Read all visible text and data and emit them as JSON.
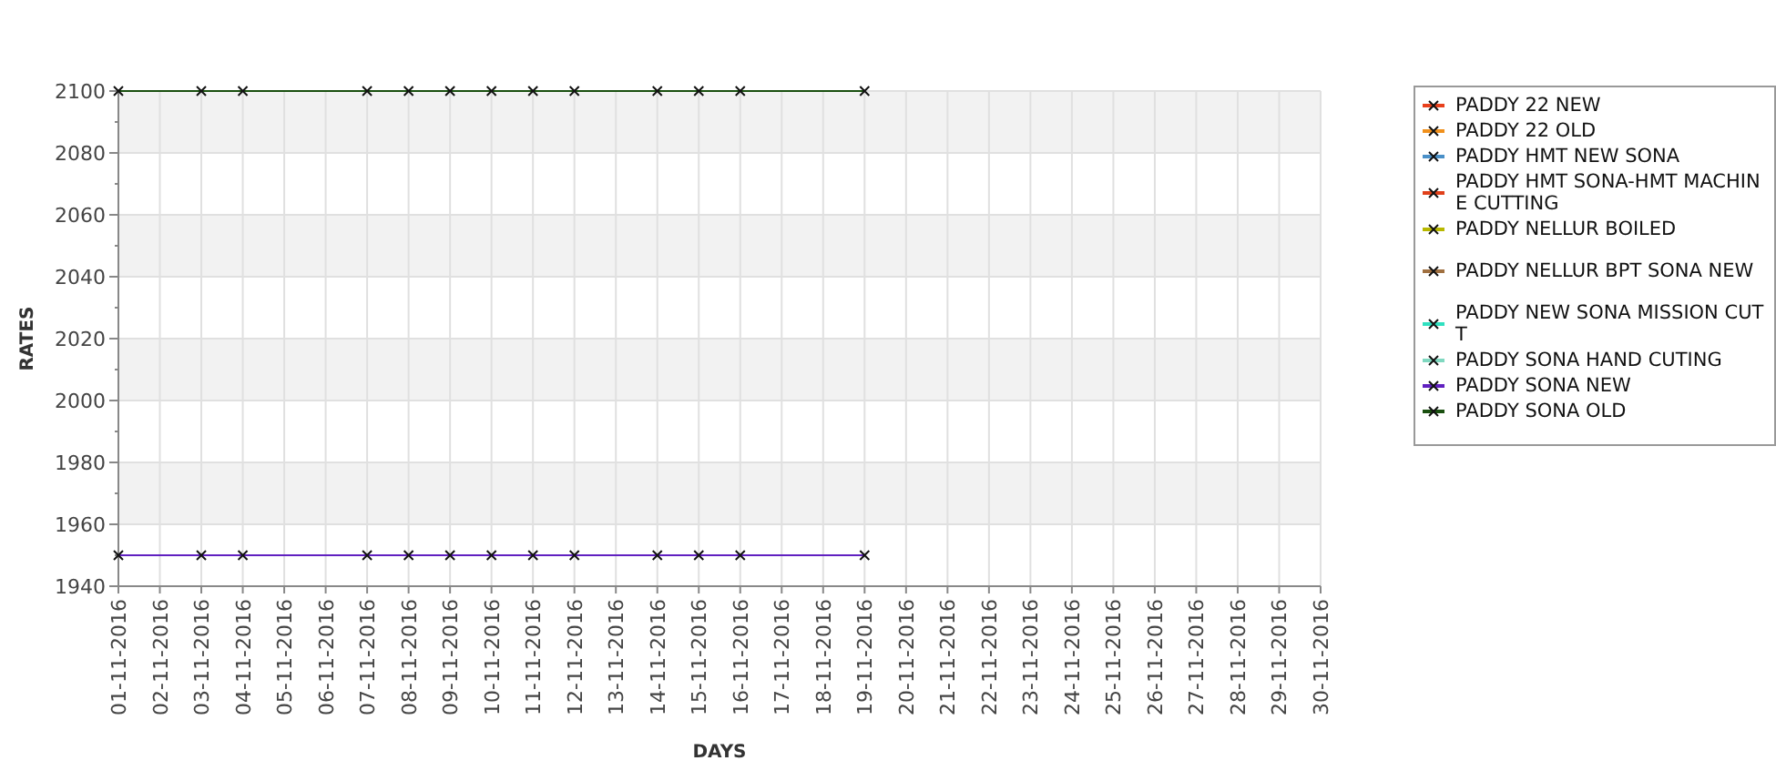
{
  "chart": {
    "chart_data": {
      "type": "line",
      "xlabel": "DAYS",
      "ylabel": "RATES",
      "categories": [
        "01-11-2016",
        "02-11-2016",
        "03-11-2016",
        "04-11-2016",
        "05-11-2016",
        "06-11-2016",
        "07-11-2016",
        "08-11-2016",
        "09-11-2016",
        "10-11-2016",
        "11-11-2016",
        "12-11-2016",
        "13-11-2016",
        "14-11-2016",
        "15-11-2016",
        "16-11-2016",
        "17-11-2016",
        "18-11-2016",
        "19-11-2016",
        "20-11-2016",
        "21-11-2016",
        "22-11-2016",
        "23-11-2016",
        "24-11-2016",
        "25-11-2016",
        "26-11-2016",
        "27-11-2016",
        "28-11-2016",
        "29-11-2016",
        "30-11-2016"
      ],
      "ylim": [
        1940,
        2100
      ],
      "grid": true,
      "yticks": [
        1940,
        1960,
        1980,
        2000,
        2020,
        2040,
        2060,
        2080,
        2100
      ],
      "series": [
        {
          "name": "PADDY 22 NEW",
          "color": "#e8401c",
          "marker": "x",
          "values": [
            null,
            null,
            null,
            null,
            null,
            null,
            null,
            null,
            null,
            null,
            null,
            null,
            null,
            null,
            null,
            null,
            null,
            null,
            null,
            null,
            null,
            null,
            null,
            null,
            null,
            null,
            null,
            null,
            null,
            null
          ]
        },
        {
          "name": "PADDY 22 OLD",
          "color": "#f0901c",
          "marker": "x",
          "values": [
            null,
            null,
            null,
            null,
            null,
            null,
            null,
            null,
            null,
            null,
            null,
            null,
            null,
            null,
            null,
            null,
            null,
            null,
            null,
            null,
            null,
            null,
            null,
            null,
            null,
            null,
            null,
            null,
            null,
            null
          ]
        },
        {
          "name": "PADDY HMT NEW SONA",
          "color": "#4a90c8",
          "marker": "x",
          "values": [
            null,
            null,
            null,
            null,
            null,
            null,
            null,
            null,
            null,
            null,
            null,
            null,
            null,
            null,
            null,
            null,
            null,
            null,
            null,
            null,
            null,
            null,
            null,
            null,
            null,
            null,
            null,
            null,
            null,
            null
          ]
        },
        {
          "name": "PADDY HMT SONA-HMT MACHINE CUTTING",
          "color": "#e0401a",
          "marker": "x",
          "values": [
            null,
            null,
            null,
            null,
            null,
            null,
            null,
            null,
            null,
            null,
            null,
            null,
            null,
            null,
            null,
            null,
            null,
            null,
            null,
            null,
            null,
            null,
            null,
            null,
            null,
            null,
            null,
            null,
            null,
            null
          ]
        },
        {
          "name": "PADDY NELLUR BOILED",
          "color": "#b8b800",
          "marker": "x",
          "values": [
            null,
            null,
            null,
            null,
            null,
            null,
            null,
            null,
            null,
            null,
            null,
            null,
            null,
            null,
            null,
            null,
            null,
            null,
            null,
            null,
            null,
            null,
            null,
            null,
            null,
            null,
            null,
            null,
            null,
            null
          ]
        },
        {
          "name": "PADDY NELLUR BPT SONA NEW",
          "color": "#a07040",
          "marker": "x",
          "values": [
            null,
            null,
            null,
            null,
            null,
            null,
            null,
            null,
            null,
            null,
            null,
            null,
            null,
            null,
            null,
            null,
            null,
            null,
            null,
            null,
            null,
            null,
            null,
            null,
            null,
            null,
            null,
            null,
            null,
            null
          ]
        },
        {
          "name": "PADDY NEW SONA MISSION CUTT",
          "color": "#30e0c0",
          "marker": "x",
          "values": [
            null,
            null,
            null,
            null,
            null,
            null,
            null,
            null,
            null,
            null,
            null,
            null,
            null,
            null,
            null,
            null,
            null,
            null,
            null,
            null,
            null,
            null,
            null,
            null,
            null,
            null,
            null,
            null,
            null,
            null
          ]
        },
        {
          "name": "PADDY SONA HAND CUTING",
          "color": "#80d8c0",
          "marker": "x",
          "values": [
            null,
            null,
            null,
            null,
            null,
            null,
            null,
            null,
            null,
            null,
            null,
            null,
            null,
            null,
            null,
            null,
            null,
            null,
            null,
            null,
            null,
            null,
            null,
            null,
            null,
            null,
            null,
            null,
            null,
            null
          ]
        },
        {
          "name": "PADDY SONA NEW",
          "color": "#6020c0",
          "marker": "x",
          "values": [
            1950,
            null,
            1950,
            1950,
            null,
            null,
            1950,
            1950,
            1950,
            1950,
            1950,
            1950,
            null,
            1950,
            1950,
            1950,
            null,
            null,
            1950,
            null,
            null,
            null,
            null,
            null,
            null,
            null,
            null,
            null,
            null,
            null
          ]
        },
        {
          "name": "PADDY SONA OLD",
          "color": "#1a5010",
          "marker": "x",
          "values": [
            2100,
            null,
            2100,
            2100,
            null,
            null,
            2100,
            2100,
            2100,
            2100,
            2100,
            2100,
            null,
            2100,
            2100,
            2100,
            null,
            null,
            2100,
            null,
            null,
            null,
            null,
            null,
            null,
            null,
            null,
            null,
            null,
            null
          ]
        }
      ]
    }
  }
}
